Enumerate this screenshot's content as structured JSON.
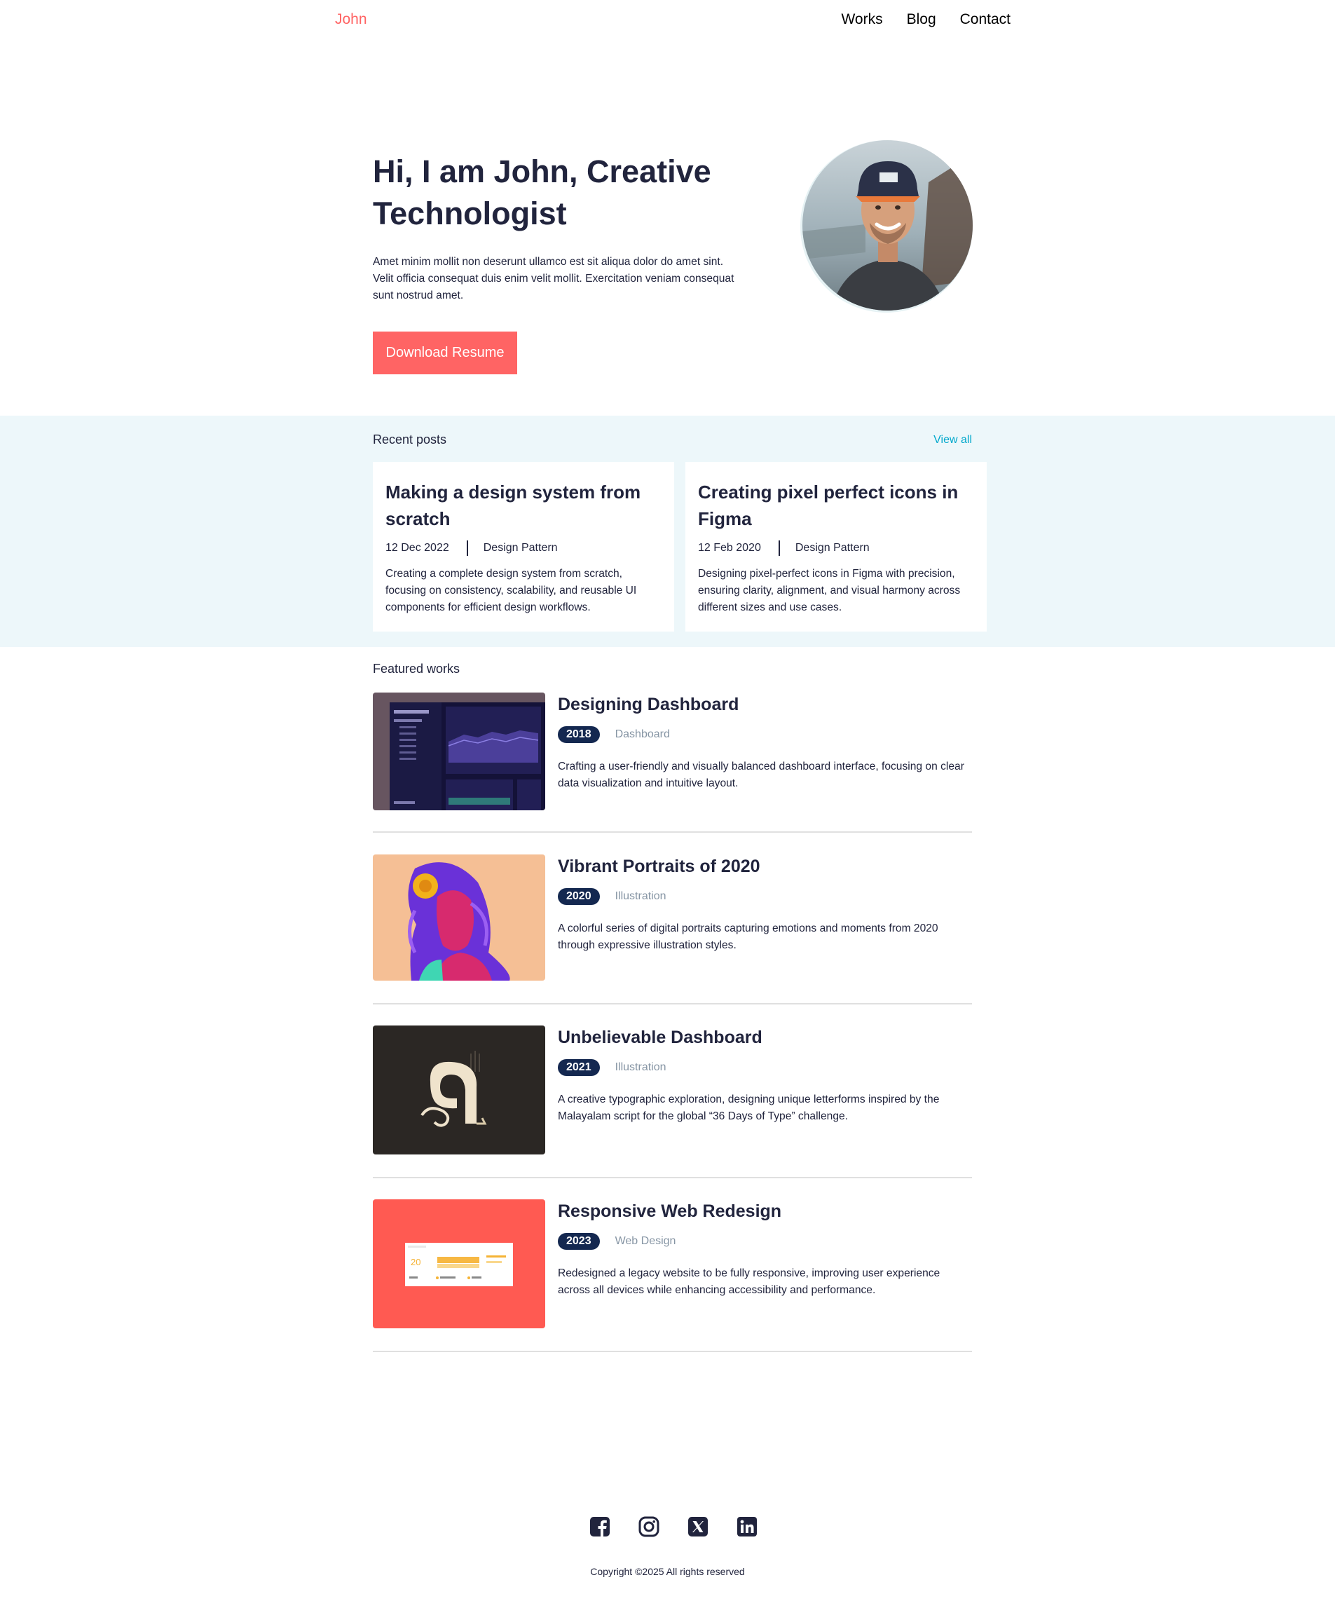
{
  "header": {
    "logo": "John",
    "nav": [
      "Works",
      "Blog",
      "Contact"
    ]
  },
  "hero": {
    "title": "Hi, I am John, Creative Technologist",
    "description": "Amet minim mollit non deserunt ullamco est sit aliqua dolor do amet sint. Velit officia consequat duis enim velit mollit. Exercitation veniam consequat sunt nostrud amet.",
    "button": "Download Resume"
  },
  "recent_posts": {
    "heading": "Recent posts",
    "view_all": "View all",
    "posts": [
      {
        "title": "Making a design system from scratch",
        "date": "12 Dec 2022",
        "category": "Design Pattern",
        "excerpt": "Creating a complete design system from scratch, focusing on consistency, scalability, and reusable UI components for efficient design workflows."
      },
      {
        "title": "Creating pixel perfect icons in Figma",
        "date": "12 Feb 2020",
        "category": "Design Pattern",
        "excerpt": "Designing pixel-perfect icons in Figma with precision, ensuring clarity, alignment, and visual harmony across different sizes and use cases."
      }
    ]
  },
  "featured_works": {
    "heading": "Featured works",
    "works": [
      {
        "title": "Designing Dashboard",
        "year": "2018",
        "category": "Dashboard",
        "description": "Crafting a user-friendly and visually balanced dashboard interface, focusing on clear data visualization and intuitive layout."
      },
      {
        "title": "Vibrant Portraits of 2020",
        "year": "2020",
        "category": "Illustration",
        "description": "A colorful series of digital portraits capturing emotions and moments from 2020 through expressive illustration styles."
      },
      {
        "title": "Unbelievable Dashboard",
        "year": "2021",
        "category": "Illustration",
        "description": "A creative typographic exploration, designing unique letterforms inspired by the Malayalam script for the global “36 Days of Type” challenge."
      },
      {
        "title": "Responsive Web Redesign",
        "year": "2023",
        "category": "Web Design",
        "description": "Redesigned a legacy website to be fully responsive, improving user experience across all devices while enhancing accessibility and performance."
      }
    ]
  },
  "footer": {
    "social_icons": [
      "facebook-icon",
      "instagram-icon",
      "x-icon",
      "linkedin-icon"
    ],
    "copyright": "Copyright ©2025 All rights reserved"
  },
  "colors": {
    "accent": "#ff6464",
    "text": "#21243d",
    "navy": "#142850",
    "light_bg": "#edf7fa",
    "link": "#00a8cc",
    "muted": "#8695a4"
  }
}
